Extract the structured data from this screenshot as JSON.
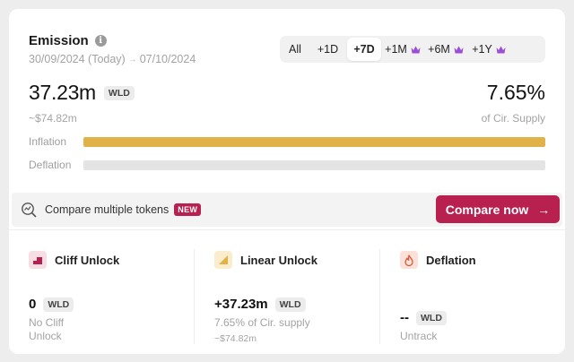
{
  "header": {
    "title": "Emission",
    "date_start": "30/09/2024 (Today)",
    "date_end": "07/10/2024"
  },
  "range_tabs": [
    {
      "label": "All",
      "active": false,
      "premium": false
    },
    {
      "label": "+1D",
      "active": false,
      "premium": false
    },
    {
      "label": "+7D",
      "active": true,
      "premium": false
    },
    {
      "label": "+1M",
      "active": false,
      "premium": true
    },
    {
      "label": "+6M",
      "active": false,
      "premium": true
    },
    {
      "label": "+1Y",
      "active": false,
      "premium": true
    }
  ],
  "summary": {
    "amount": "37.23m",
    "token": "WLD",
    "usd": "~$74.82m",
    "percent": "7.65%",
    "percent_label": "of Cir. Supply"
  },
  "bars": {
    "inflation": {
      "label": "Inflation",
      "fill_fraction": 1.0,
      "color": "#e2b24a"
    },
    "deflation": {
      "label": "Deflation",
      "fill_fraction": 0.0,
      "color": "#e4e4e4"
    }
  },
  "compare": {
    "text": "Compare multiple tokens",
    "badge": "NEW",
    "button_label": "Compare now"
  },
  "columns": {
    "cliff": {
      "title": "Cliff Unlock",
      "value": "0",
      "token": "WLD",
      "sub": "No Cliff Unlock",
      "icon_color": "#b8204f",
      "icon_bg": "#f7dde4"
    },
    "linear": {
      "title": "Linear Unlock",
      "value": "+37.23m",
      "token": "WLD",
      "sub": "7.65% of Cir. supply",
      "usd": "~$74.82m",
      "icon_color": "#e2b24a",
      "icon_bg": "#fbeccb"
    },
    "deflation": {
      "title": "Deflation",
      "value": "--",
      "token": "WLD",
      "sub": "Untrack",
      "icon_color": "#d45c3c",
      "icon_bg": "#fbe1d8"
    }
  },
  "colors": {
    "accent": "#b8204f",
    "inflation": "#e2b24a",
    "muted_text": "#a3a3a3"
  }
}
